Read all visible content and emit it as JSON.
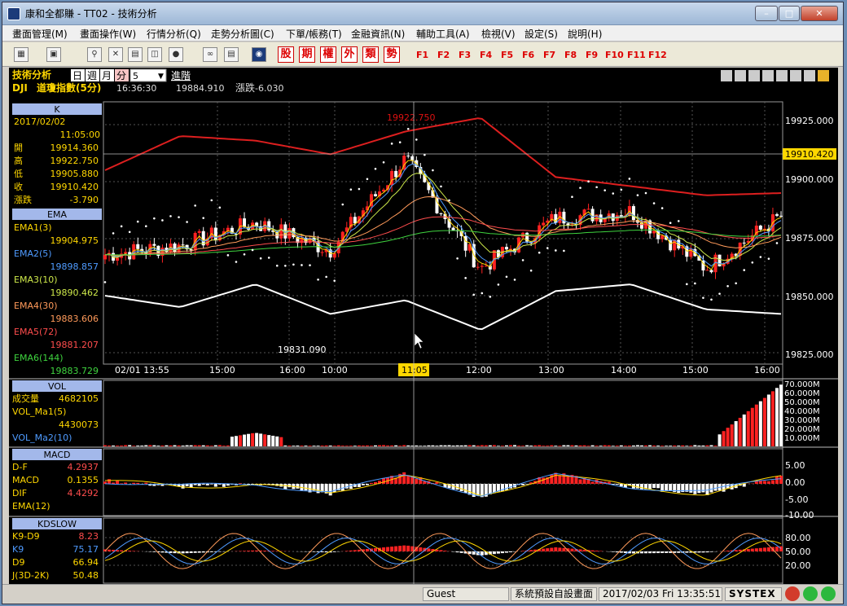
{
  "window": {
    "title": "康和全都賺 - TT02 - 技術分析"
  },
  "menu": [
    "畫面管理(M)",
    "畫面操作(W)",
    "行情分析(Q)",
    "走勢分析圖(C)",
    "下單/帳務(T)",
    "金融資訊(N)",
    "輔助工具(A)",
    "檢視(V)",
    "設定(S)",
    "說明(H)"
  ],
  "toolbar": {
    "keys": [
      "股",
      "期",
      "權",
      "外",
      "類",
      "勢"
    ],
    "fkeys": [
      "F1",
      "F2",
      "F3",
      "F4",
      "F5",
      "F6",
      "F7",
      "F8",
      "F9",
      "F10",
      "F11",
      "F12"
    ]
  },
  "chart_header": {
    "title": "技術分析",
    "periods": [
      "日",
      "週",
      "月",
      "分"
    ],
    "interval": "5",
    "advanced": "進階",
    "symbol": "DJI",
    "name": "道瓊指數(5分)",
    "time": "16:36:30",
    "price": "19884.910",
    "change_label": "漲跌",
    "change": "-6.030"
  },
  "panel_k": {
    "title": "K",
    "date": "2017/02/02",
    "time": "11:05:00",
    "rows": [
      {
        "label": "開",
        "value": "19914.360"
      },
      {
        "label": "高",
        "value": "19922.750"
      },
      {
        "label": "低",
        "value": "19905.880"
      },
      {
        "label": "收",
        "value": "19910.420"
      },
      {
        "label": "漲跌",
        "value": "-3.790"
      }
    ]
  },
  "panel_ema": {
    "title": "EMA",
    "rows": [
      {
        "label": "EMA1(3)",
        "value": "19904.975",
        "color": "#ffd700"
      },
      {
        "label": "EMA2(5)",
        "value": "19898.857",
        "color": "#4f9bff"
      },
      {
        "label": "EMA3(10)",
        "value": "19890.462",
        "color": "#cde84a"
      },
      {
        "label": "EMA4(30)",
        "value": "19883.606",
        "color": "#ff9a5a"
      },
      {
        "label": "EMA5(72)",
        "value": "19881.207",
        "color": "#ff4d4d"
      },
      {
        "label": "EMA6(144)",
        "value": "19883.729",
        "color": "#3fd43f"
      }
    ]
  },
  "panel_vol": {
    "title": "VOL",
    "rows": [
      {
        "label": "成交量",
        "value": "4682105"
      },
      {
        "label": "VOL_Ma1(5)",
        "value": ""
      },
      {
        "label": "",
        "value": "4430073"
      },
      {
        "label": "VOL_Ma2(10)",
        "value": ""
      }
    ]
  },
  "panel_macd": {
    "title": "MACD",
    "rows": [
      {
        "label": "D-F",
        "value": "4.2937"
      },
      {
        "label": "MACD",
        "value": "0.1355"
      },
      {
        "label": "DIF",
        "value": "4.4292"
      },
      {
        "label": "EMA(12)",
        "value": ""
      }
    ]
  },
  "panel_kd": {
    "title": "KDSLOW",
    "rows": [
      {
        "label": "K9-D9",
        "value": "8.23"
      },
      {
        "label": "K9",
        "value": "75.17"
      },
      {
        "label": "D9",
        "value": "66.94"
      },
      {
        "label": "J(3D-2K)",
        "value": "50.48"
      }
    ]
  },
  "annotations": {
    "high": "19922.750",
    "low": "19831.090",
    "cursor_price": "19910.420",
    "cursor_time": "11:05"
  },
  "axes": {
    "price_ticks": [
      "19925.000",
      "19900.000",
      "19875.000",
      "19850.000",
      "19825.000"
    ],
    "time_ticks": [
      "02/01 13:55",
      "15:00",
      "16:00",
      "10:00",
      "12:00",
      "13:00",
      "14:00",
      "15:00",
      "16:00"
    ],
    "vol_ticks": [
      "70.000M",
      "60.000M",
      "50.000M",
      "40.000M",
      "30.000M",
      "20.000M",
      "10.000M"
    ],
    "macd_ticks": [
      "5.00",
      "0.00",
      "-5.00",
      "-10.00"
    ],
    "kd_ticks": [
      "80.00",
      "50.00",
      "20.00"
    ]
  },
  "chart_data": {
    "type": "candlestick",
    "symbol": "DJI",
    "interval_min": 5,
    "ylim": [
      19820,
      19935
    ],
    "x": [
      "02/01 13:55",
      "15:00",
      "16:00",
      "10:00",
      "11:05",
      "12:00",
      "13:00",
      "14:00",
      "15:00",
      "16:00"
    ],
    "close": [
      19868,
      19872,
      19882,
      19870,
      19910,
      19862,
      19884,
      19887,
      19862,
      19885
    ],
    "bb_upper": [
      19905,
      19920,
      19918,
      19912,
      19922,
      19928,
      19902,
      19898,
      19894,
      19895
    ],
    "bb_lower": [
      19850,
      19845,
      19855,
      19842,
      19848,
      19835,
      19852,
      19855,
      19844,
      19842
    ],
    "volume_m": [
      1,
      1,
      15,
      1,
      1,
      1,
      1,
      1,
      1,
      68
    ],
    "macd_hist": [
      1,
      -1,
      0,
      -3,
      3,
      -4,
      3,
      -1,
      -3,
      2
    ],
    "k": [
      60,
      40,
      55,
      45,
      80,
      30,
      70,
      40,
      45,
      75
    ]
  },
  "status": {
    "user": "Guest",
    "layout": "系統預設自設畫面",
    "datetime": "2017/02/03 Fri 13:35:51",
    "brand": "SYSTEX"
  }
}
